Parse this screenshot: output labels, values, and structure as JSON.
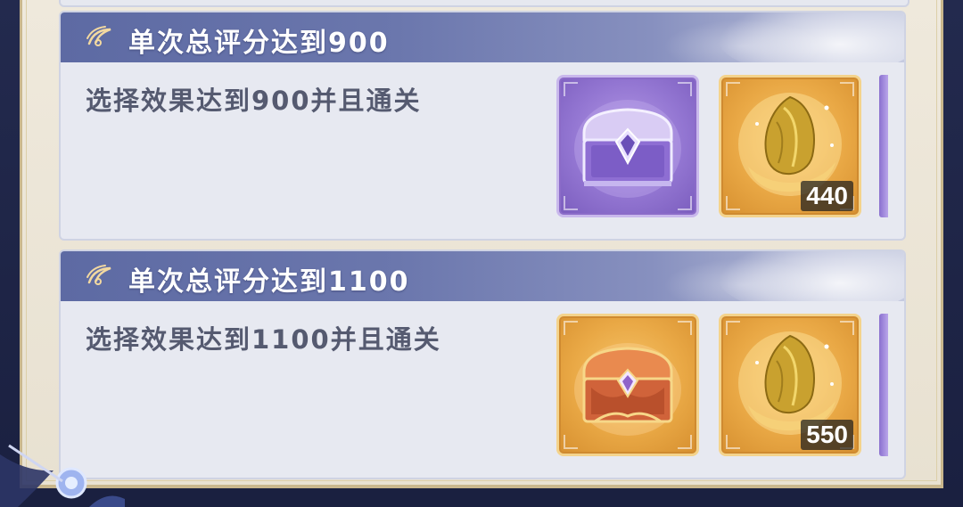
{
  "tasks": [
    {
      "title": "单次总评分达到900",
      "description": "选择效果达到900并且通关",
      "rewards": [
        {
          "icon": "purple-chest-icon",
          "quantity": ""
        },
        {
          "icon": "golden-seed-icon",
          "quantity": "440"
        }
      ]
    },
    {
      "title": "单次总评分达到1100",
      "description": "选择效果达到1100并且通关",
      "rewards": [
        {
          "icon": "orange-chest-icon",
          "quantity": ""
        },
        {
          "icon": "golden-seed-icon",
          "quantity": "550"
        }
      ]
    }
  ],
  "colors": {
    "header": "#6b77ad",
    "purple_frame": "#9376d2",
    "gold_frame": "#e9a845",
    "description_text": "#555a70"
  }
}
